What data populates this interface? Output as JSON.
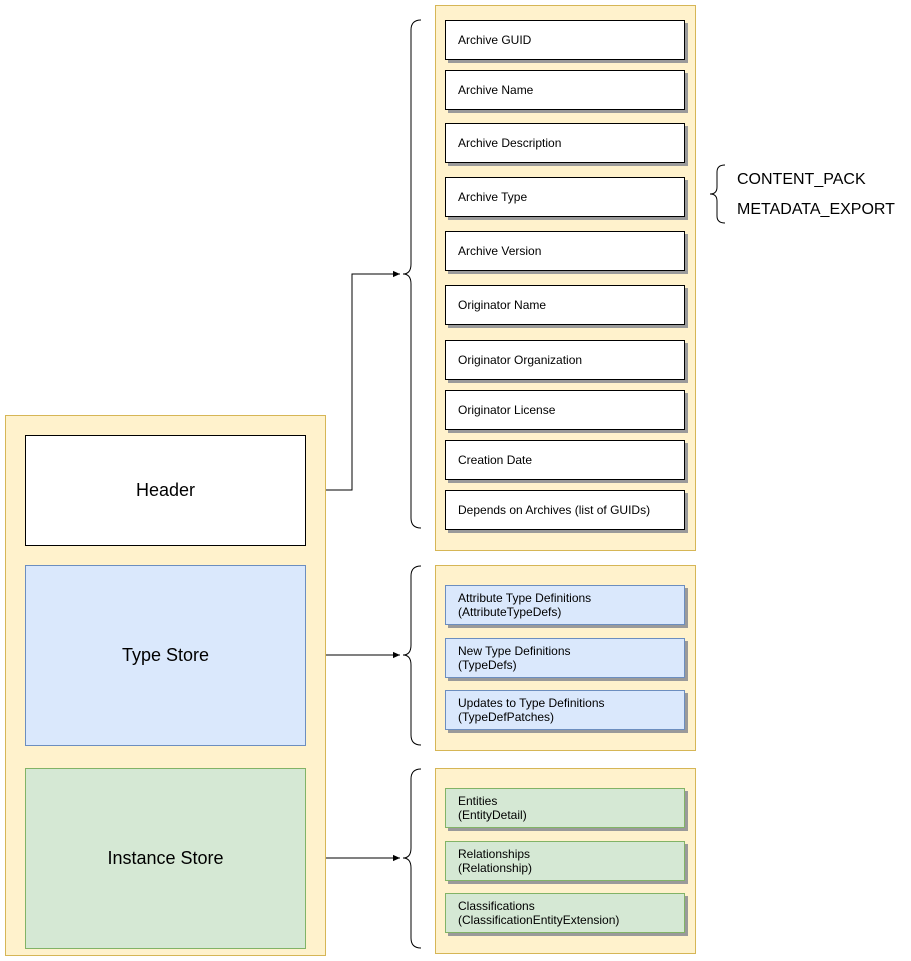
{
  "main_sections": {
    "header": "Header",
    "type_store": "Type Store",
    "instance_store": "Instance Store"
  },
  "header_fields": [
    "Archive GUID",
    "Archive Name",
    "Archive Description",
    "Archive Type",
    "Archive Version",
    "Originator Name",
    "Originator Organization",
    "Originator License",
    "Creation Date",
    "Depends on Archives (list of GUIDs)"
  ],
  "type_store_fields": [
    {
      "line1": "Attribute Type Definitions",
      "line2": "(AttributeTypeDefs)"
    },
    {
      "line1": "New Type Definitions",
      "line2": "(TypeDefs)"
    },
    {
      "line1": "Updates to Type Definitions",
      "line2": "(TypeDefPatches)"
    }
  ],
  "instance_store_fields": [
    {
      "line1": "Entities",
      "line2": "(EntityDetail)"
    },
    {
      "line1": "Relationships",
      "line2": "(Relationship)"
    },
    {
      "line1": "Classifications",
      "line2": "(ClassificationEntityExtension)"
    }
  ],
  "archive_type_values": [
    "CONTENT_PACK",
    "METADATA_EXPORT"
  ],
  "colors": {
    "panel_fill": "#fff2cc",
    "panel_border": "#d6b656",
    "type_fill": "#dae8fc",
    "type_border": "#6c8ebf",
    "instance_fill": "#d5e8d4",
    "instance_border": "#82b366"
  }
}
